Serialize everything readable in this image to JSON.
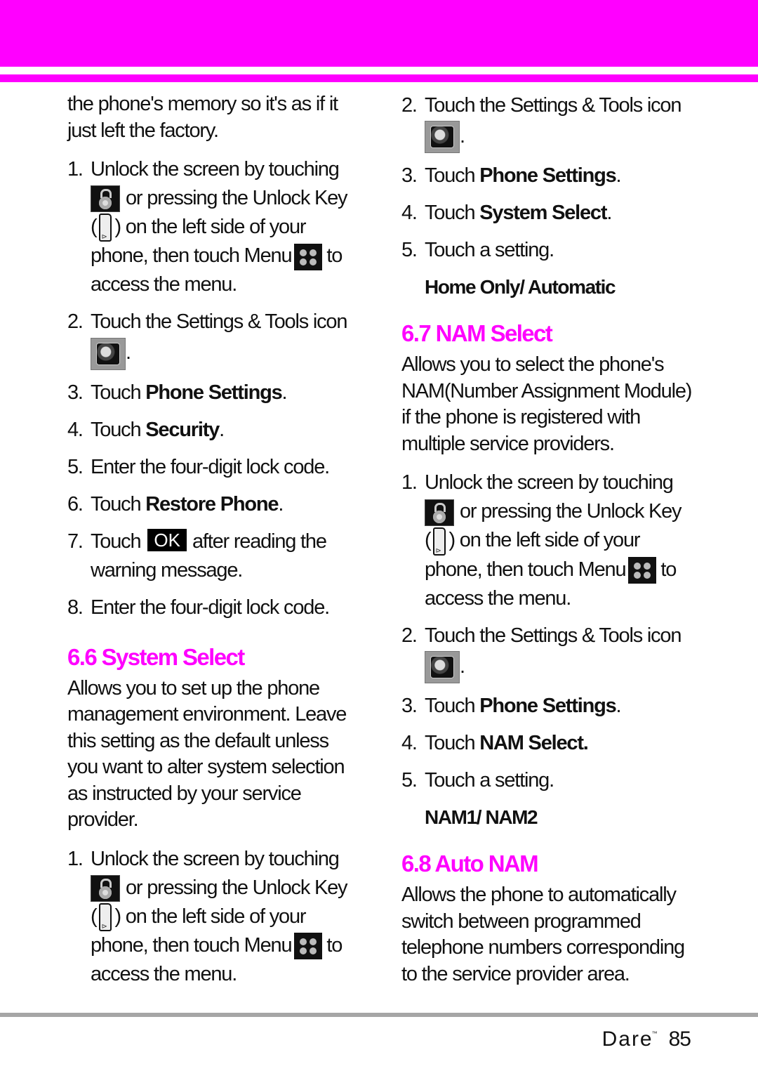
{
  "header": {
    "band_color": "#ff00ff"
  },
  "left": {
    "intro": "the phone's memory so it's as if it just left the factory.",
    "steps": [
      {
        "num": "1.",
        "pre": "Unlock the screen by touching",
        "mid1": "or pressing the Unlock Key",
        "mid2": ") on the left side of your",
        "mid3": "phone, then touch Menu",
        "mid4": "to",
        "end": "access the menu.",
        "open_paren": "("
      },
      {
        "num": "2.",
        "text": "Touch the Settings & Tools icon",
        "end": "."
      },
      {
        "num": "3.",
        "pre": "Touch ",
        "bold": "Phone Settings",
        "post": "."
      },
      {
        "num": "4.",
        "pre": "Touch ",
        "bold": "Security",
        "post": "."
      },
      {
        "num": "5.",
        "text": "Enter the four-digit lock code."
      },
      {
        "num": "6.",
        "pre": "Touch ",
        "bold": "Restore Phone",
        "post": "."
      },
      {
        "num": "7.",
        "pre": "Touch",
        "button": "OK",
        "post": "after reading the",
        "end": "warning message."
      },
      {
        "num": "8.",
        "text": "Enter the four-digit lock code."
      }
    ],
    "section": {
      "title": "6.6 System Select",
      "description": "Allows you to set up the phone management environment. Leave this setting as the default unless you want to alter system selection as instructed by your service provider.",
      "steps": [
        {
          "num": "1.",
          "pre": "Unlock the screen by touching",
          "mid1": "or pressing the Unlock Key",
          "mid2": ") on the left side of your",
          "mid3": "phone, then touch Menu",
          "mid4": "to",
          "end": "access the menu.",
          "open_paren": "("
        }
      ]
    }
  },
  "right": {
    "steps": [
      {
        "num": "2.",
        "text": "Touch the Settings & Tools icon",
        "end": "."
      },
      {
        "num": "3.",
        "pre": "Touch ",
        "bold": "Phone Settings",
        "post": "."
      },
      {
        "num": "4.",
        "pre": "Touch ",
        "bold": "System Select",
        "post": "."
      },
      {
        "num": "5.",
        "text": "Touch a setting."
      }
    ],
    "option": "Home Only/ Automatic",
    "nam_section": {
      "title": "6.7 NAM Select",
      "description": "Allows you to select the phone's NAM(Number Assignment Module) if the phone is registered with multiple service providers.",
      "steps": [
        {
          "num": "1.",
          "pre": "Unlock the screen by touching",
          "mid1": "or pressing the Unlock Key",
          "mid2": ") on the left side of your",
          "mid3": "phone, then touch Menu",
          "mid4": "to",
          "end": "access the menu.",
          "open_paren": "("
        },
        {
          "num": "2.",
          "text": "Touch the Settings & Tools icon",
          "end": "."
        },
        {
          "num": "3.",
          "pre": "Touch ",
          "bold": "Phone Settings",
          "post": "."
        },
        {
          "num": "4.",
          "pre": "Touch ",
          "bold": "NAM Select.",
          "post": ""
        },
        {
          "num": "5.",
          "text": "Touch a setting."
        }
      ],
      "option": "NAM1/ NAM2"
    },
    "auto_section": {
      "title": "6.8 Auto NAM",
      "description": "Allows the phone to automatically switch between programmed telephone numbers corresponding to the service provider area."
    }
  },
  "footer": {
    "brand": "Dare",
    "trademark": "™",
    "page_number": "85"
  },
  "icons": {
    "lock": "unlock-icon",
    "key": "unlock-key-icon",
    "menu": "menu-icon",
    "settings": "settings-tools-icon"
  }
}
